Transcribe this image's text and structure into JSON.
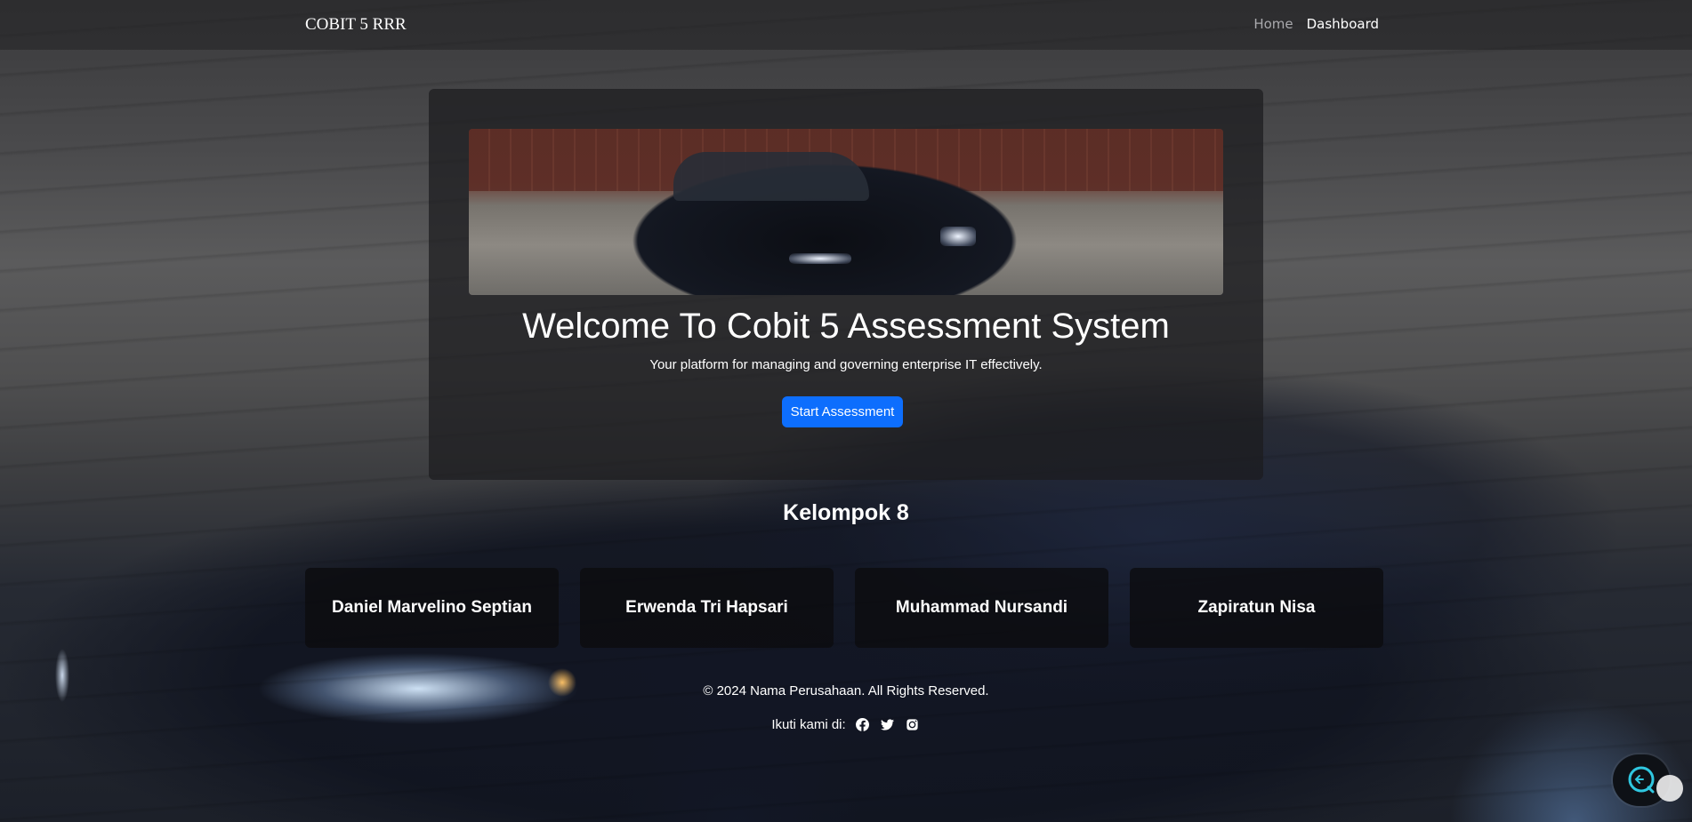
{
  "navbar": {
    "brand": "COBIT 5 RRR",
    "links": [
      {
        "label": "Home",
        "active": false
      },
      {
        "label": "Dashboard",
        "active": true
      }
    ]
  },
  "hero": {
    "title": "Welcome To Cobit 5 Assessment System",
    "subtitle": "Your platform for managing and governing enterprise IT effectively.",
    "button_label": "Start Assessment"
  },
  "team": {
    "title": "Kelompok 8",
    "members": [
      "Daniel Marvelino Septian",
      "Erwenda Tri Hapsari",
      "Muhammad Nursandi",
      "Zapiratun Nisa"
    ]
  },
  "footer": {
    "copyright": "© 2024 Nama Perusahaan. All Rights Reserved.",
    "follow_label": "Ikuti kami di:",
    "social_icons": [
      "facebook-icon",
      "twitter-icon",
      "instagram-icon"
    ]
  },
  "colors": {
    "primary_button": "#0d6efd",
    "nav_inactive": "#a9a9ad"
  }
}
